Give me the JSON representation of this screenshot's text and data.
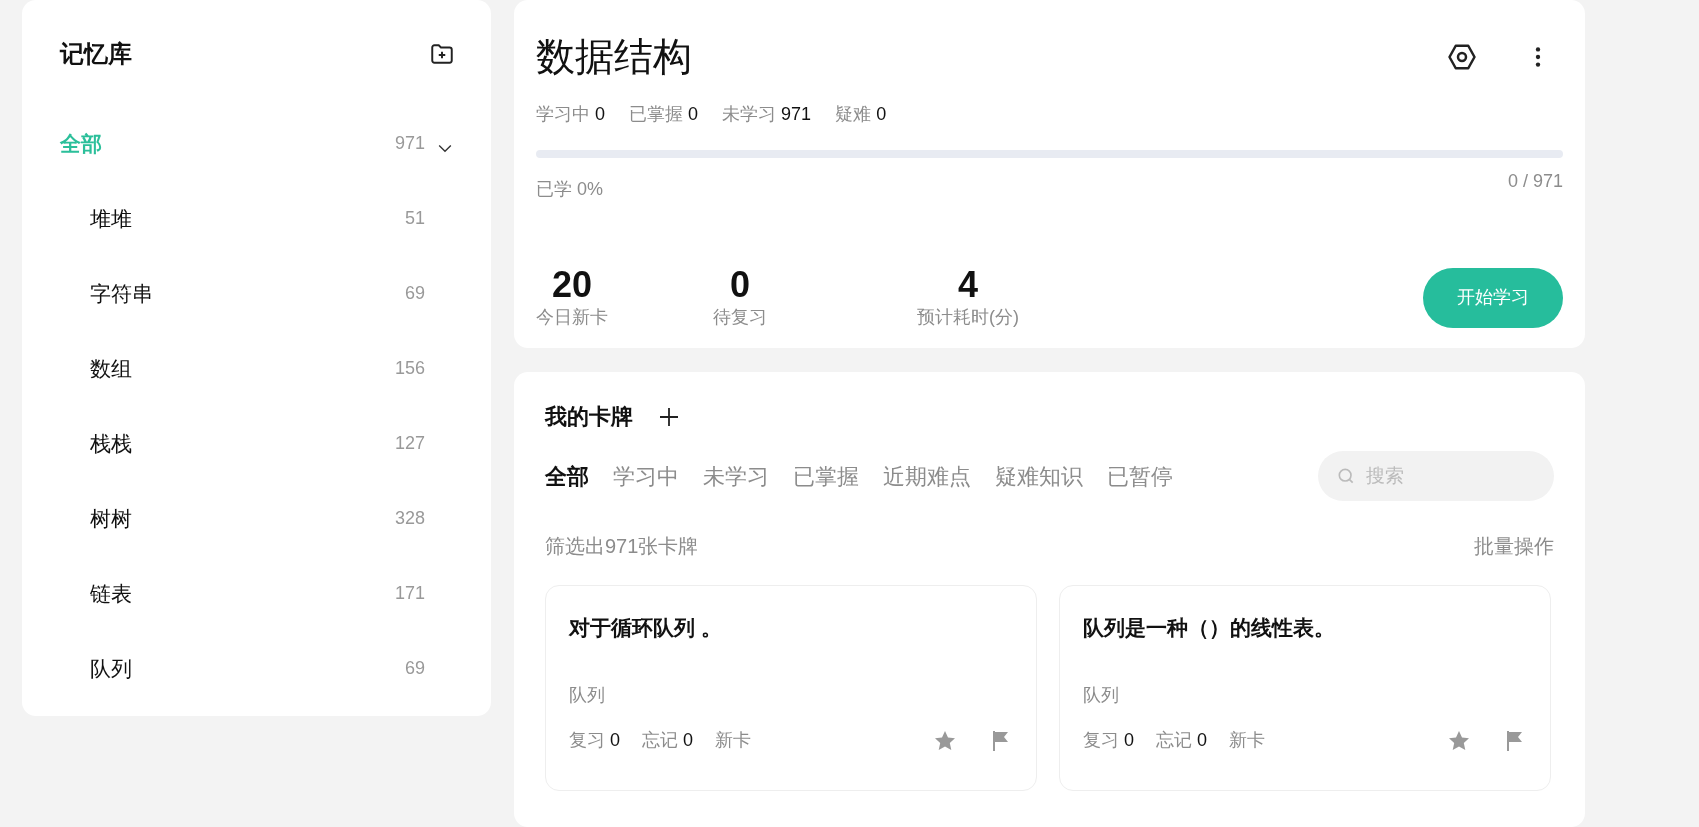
{
  "sidebar": {
    "title": "记忆库",
    "items": [
      {
        "label": "全部",
        "count": "971",
        "selected": true,
        "expanded": true,
        "children": [
          {
            "label": "堆堆",
            "count": "51",
            "selected": false
          },
          {
            "label": "字符串",
            "count": "69",
            "selected": false
          },
          {
            "label": "数组",
            "count": "156",
            "selected": false
          },
          {
            "label": "栈栈",
            "count": "127",
            "selected": false
          },
          {
            "label": "树树",
            "count": "328",
            "selected": false
          },
          {
            "label": "链表",
            "count": "171",
            "selected": false
          },
          {
            "label": "队列",
            "count": "69",
            "selected": false
          }
        ]
      }
    ]
  },
  "deck": {
    "title": "数据结构",
    "stats": [
      {
        "label": "学习中",
        "value": "0"
      },
      {
        "label": "已掌握",
        "value": "0"
      },
      {
        "label": "未学习",
        "value": "971"
      },
      {
        "label": "疑难",
        "value": "0"
      }
    ],
    "progress": {
      "level": 0,
      "learned": "已学 0%",
      "count": "0 / 971"
    },
    "metrics": [
      {
        "value": "20",
        "label": "今日新卡"
      },
      {
        "value": "0",
        "label": "待复习"
      },
      {
        "value": "4",
        "label": "预计耗时(分)"
      }
    ],
    "start_button": "开始学习"
  },
  "cards_panel": {
    "title": "我的卡牌",
    "tabs": [
      {
        "label": "全部",
        "selected": true
      },
      {
        "label": "学习中",
        "selected": false
      },
      {
        "label": "未学习",
        "selected": false
      },
      {
        "label": "已掌握",
        "selected": false
      },
      {
        "label": "近期难点",
        "selected": false
      },
      {
        "label": "疑难知识",
        "selected": false
      },
      {
        "label": "已暂停",
        "selected": false
      }
    ],
    "search": {
      "placeholder": "搜索"
    },
    "filter_text": "筛选出971张卡牌",
    "batch_action": "批量操作",
    "cards": [
      {
        "question": "对于循环队列 。",
        "tag": "队列",
        "stats": [
          {
            "label": "复习",
            "value": "0"
          },
          {
            "label": "忘记",
            "value": "0"
          }
        ],
        "status": "新卡",
        "starred": false,
        "flagged": false
      },
      {
        "question": "队列是一种（）的线性表。",
        "tag": "队列",
        "stats": [
          {
            "label": "复习",
            "value": "0"
          },
          {
            "label": "忘记",
            "value": "0"
          }
        ],
        "status": "新卡",
        "starred": false,
        "flagged": false
      }
    ]
  }
}
